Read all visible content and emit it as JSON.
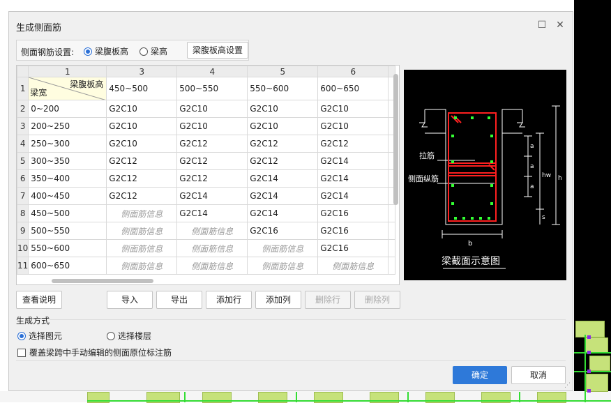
{
  "dialog": {
    "title": "生成侧面筋",
    "setting_label": "侧面钢筋设置:",
    "radio_web_height": "梁腹板高",
    "radio_beam_height": "梁高",
    "web_height_button": "梁腹板高设置"
  },
  "grid": {
    "col_headers": [
      "1",
      "3",
      "4",
      "5",
      "6"
    ],
    "corner_top": "梁腹板高",
    "corner_bottom": "梁宽",
    "header_row": [
      "450~500",
      "500~550",
      "550~600",
      "600~650"
    ],
    "rows": [
      {
        "num": "2",
        "range": "0~200",
        "cells": [
          "G2C10",
          "G2C10",
          "G2C10",
          "G2C10"
        ]
      },
      {
        "num": "3",
        "range": "200~250",
        "cells": [
          "G2C10",
          "G2C10",
          "G2C10",
          "G2C10"
        ]
      },
      {
        "num": "4",
        "range": "250~300",
        "cells": [
          "G2C10",
          "G2C12",
          "G2C12",
          "G2C12"
        ]
      },
      {
        "num": "5",
        "range": "300~350",
        "cells": [
          "G2C12",
          "G2C12",
          "G2C12",
          "G2C14"
        ]
      },
      {
        "num": "6",
        "range": "350~400",
        "cells": [
          "G2C12",
          "G2C12",
          "G2C14",
          "G2C14"
        ]
      },
      {
        "num": "7",
        "range": "400~450",
        "cells": [
          "G2C12",
          "G2C14",
          "G2C14",
          "G2C14"
        ]
      },
      {
        "num": "8",
        "range": "450~500",
        "cells": [
          "侧面筋信息",
          "G2C14",
          "G2C14",
          "G2C16"
        ]
      },
      {
        "num": "9",
        "range": "500~550",
        "cells": [
          "侧面筋信息",
          "侧面筋信息",
          "G2C16",
          "G2C16"
        ]
      },
      {
        "num": "10",
        "range": "550~600",
        "cells": [
          "侧面筋信息",
          "侧面筋信息",
          "侧面筋信息",
          "G2C16"
        ]
      },
      {
        "num": "11",
        "range": "600~650",
        "cells": [
          "侧面筋信息",
          "侧面筋信息",
          "侧面筋信息",
          "侧面筋信息"
        ]
      }
    ]
  },
  "diagram": {
    "label_tie": "拉筋",
    "label_side": "侧面纵筋",
    "label_a1": "a",
    "label_a2": "a",
    "label_a3": "a",
    "label_hw": "hw",
    "label_h": "h",
    "label_s": "s",
    "label_b": "b",
    "caption": "梁截面示意图"
  },
  "buttons": {
    "view_help": "查看说明",
    "import": "导入",
    "export": "导出",
    "add_row": "添加行",
    "add_col": "添加列",
    "del_row": "删除行",
    "del_col": "删除列",
    "ok": "确定",
    "cancel": "取消"
  },
  "generate": {
    "section": "生成方式",
    "select_element": "选择图元",
    "select_floor": "选择楼层",
    "overwrite_label": "覆盖梁跨中手动编辑的侧面原位标注筋"
  },
  "colors": {
    "primary": "#2e79d9",
    "rebar_red": "#ff2020",
    "rebar_green": "#33ff33"
  }
}
